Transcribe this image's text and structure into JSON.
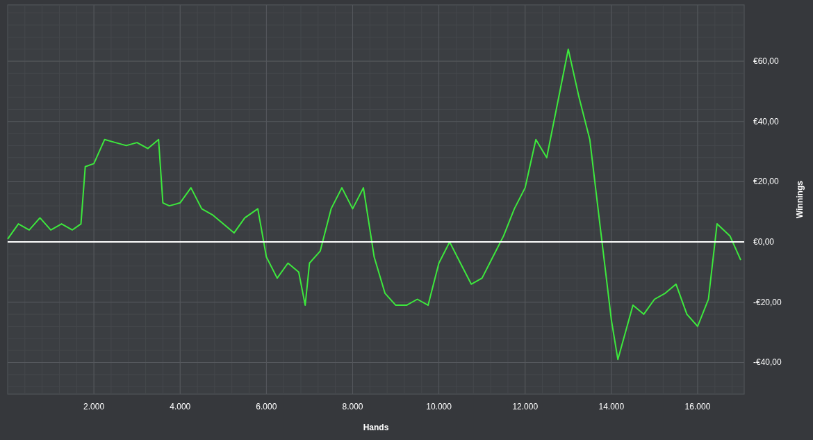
{
  "chart_data": {
    "type": "line",
    "xlabel": "Hands",
    "ylabel": "Winnings",
    "xlim": [
      0,
      17080
    ],
    "ylim": [
      -50.5,
      78.7
    ],
    "xticks": [
      {
        "value": 2000,
        "label": "2.000"
      },
      {
        "value": 4000,
        "label": "4.000"
      },
      {
        "value": 6000,
        "label": "6.000"
      },
      {
        "value": 8000,
        "label": "8.000"
      },
      {
        "value": 10000,
        "label": "10.000"
      },
      {
        "value": 12000,
        "label": "12.000"
      },
      {
        "value": 14000,
        "label": "14.000"
      },
      {
        "value": 16000,
        "label": "16.000"
      }
    ],
    "yticks": [
      {
        "value": 60,
        "label": "€60,00"
      },
      {
        "value": 40,
        "label": "€40,00"
      },
      {
        "value": 20,
        "label": "€20,00"
      },
      {
        "value": 0,
        "label": "€0,00"
      },
      {
        "value": -20,
        "label": "-€20,00"
      },
      {
        "value": -40,
        "label": "-€40,00"
      }
    ],
    "x": [
      0,
      250,
      500,
      750,
      1000,
      1250,
      1500,
      1700,
      1800,
      2000,
      2250,
      2500,
      2750,
      3000,
      3250,
      3500,
      3600,
      3750,
      4000,
      4250,
      4500,
      4750,
      5000,
      5250,
      5500,
      5800,
      6000,
      6250,
      6500,
      6750,
      6900,
      7000,
      7250,
      7500,
      7750,
      8000,
      8250,
      8500,
      8750,
      9000,
      9250,
      9500,
      9750,
      10000,
      10250,
      10500,
      10750,
      11000,
      11250,
      11500,
      11750,
      12000,
      12250,
      12500,
      12750,
      13000,
      13250,
      13500,
      13750,
      14000,
      14150,
      14500,
      14750,
      15000,
      15250,
      15500,
      15750,
      16000,
      16250,
      16450,
      16750,
      17000
    ],
    "series": [
      {
        "color": "#3de83d",
        "values": [
          1,
          6,
          4,
          8,
          4,
          6,
          4,
          6,
          25,
          26,
          34,
          33,
          32,
          33,
          31,
          34,
          13,
          12,
          13,
          18,
          11,
          9,
          6,
          3,
          8,
          11,
          -5,
          -12,
          -7,
          -10,
          -21,
          -7,
          -3,
          11,
          18,
          11,
          18,
          -5,
          -17,
          -21,
          -21,
          -19,
          -21,
          -7,
          0,
          -7,
          -14,
          -12,
          -5,
          2,
          11,
          18,
          34,
          28,
          46,
          64,
          48,
          34,
          4,
          -26,
          -39,
          -21,
          -24,
          -19,
          -17,
          -14,
          -24,
          -28,
          -19,
          6,
          2,
          -6
        ]
      }
    ],
    "grid": true,
    "ref_lines": [
      {
        "axis": "y",
        "value": 0,
        "color": "#ffffff"
      }
    ]
  }
}
